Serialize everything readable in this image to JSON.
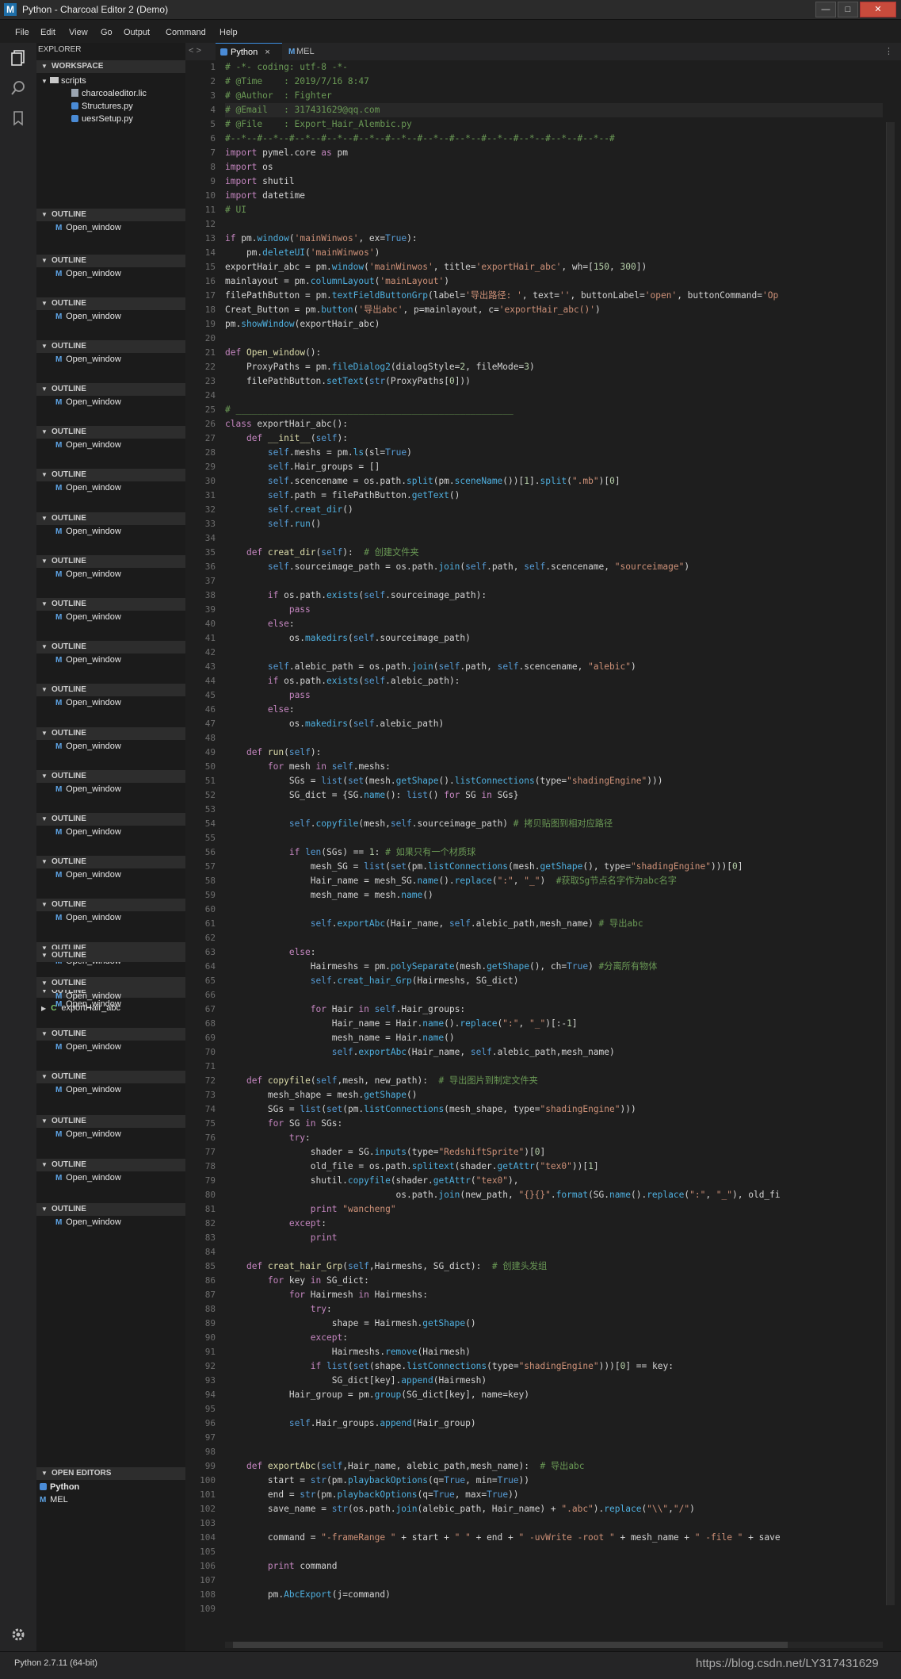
{
  "window": {
    "logo": "M",
    "title": "Python - Charcoal Editor 2 (Demo)",
    "buttons": [
      "—",
      "□",
      "✕"
    ]
  },
  "menubar": [
    "File",
    "Edit",
    "View",
    "Go",
    "Output",
    "Command",
    "Help"
  ],
  "explorer": {
    "title": "EXPLORER",
    "workspace_label": "WORKSPACE",
    "folder": "scripts",
    "files": [
      "charcoaleditor.lic",
      "Structures.py",
      "uesrSetup.py"
    ],
    "outline_label": "OUTLINE",
    "outline_item": "Open_window",
    "last_outline": [
      "Open_window",
      "exportHair_abc"
    ],
    "open_editors_label": "OPEN EDITORS",
    "open_editors": [
      "Python",
      "MEL"
    ]
  },
  "tabs": [
    {
      "label": "Python",
      "close": "×"
    },
    {
      "label": "MEL"
    }
  ],
  "code_lines": [
    "# -*- coding: utf-8 -*-",
    "# @Time    : 2019/7/16 8:47",
    "# @Author  : Fighter",
    "# @Email   : 317431629@qq.com",
    "# @File    : Export_Hair_Alembic.py",
    "#--*--#--*--#--*--#--*--#--*--#--*--#--*--#--*--#--*--#--*--#--*--#--*--#",
    "import pymel.core as pm",
    "import os",
    "import shutil",
    "import datetime",
    "# UI",
    "",
    "if pm.window('mainWinwos', ex=True):",
    "    pm.deleteUI('mainWinwos')",
    "exportHair_abc = pm.window('mainWinwos', title='exportHair_abc', wh=[150, 300])",
    "mainlayout = pm.columnLayout('mainLayout')",
    "filePathButton = pm.textFieldButtonGrp(label='导出路径: ', text='', buttonLabel='open', buttonCommand='Op",
    "Creat_Button = pm.button('导出abc', p=mainlayout, c='exportHair_abc()')",
    "pm.showWindow(exportHair_abc)",
    "",
    "def Open_window():",
    "    ProxyPaths = pm.fileDialog2(dialogStyle=2, fileMode=3)",
    "    filePathButton.setText(str(ProxyPaths[0]))",
    "",
    "# ____________________________________________________",
    "class exportHair_abc():",
    "    def __init__(self):",
    "        self.meshs = pm.ls(sl=True)",
    "        self.Hair_groups = []",
    "        self.scencename = os.path.split(pm.sceneName())[1].split(\".mb\")[0]",
    "        self.path = filePathButton.getText()",
    "        self.creat_dir()",
    "        self.run()",
    "",
    "    def creat_dir(self):  # 创建文件夹",
    "        self.sourceimage_path = os.path.join(self.path, self.scencename, \"sourceimage\")",
    "",
    "        if os.path.exists(self.sourceimage_path):",
    "            pass",
    "        else:",
    "            os.makedirs(self.sourceimage_path)",
    "",
    "        self.alebic_path = os.path.join(self.path, self.scencename, \"alebic\")",
    "        if os.path.exists(self.alebic_path):",
    "            pass",
    "        else:",
    "            os.makedirs(self.alebic_path)",
    "",
    "    def run(self):",
    "        for mesh in self.meshs:",
    "            SGs = list(set(mesh.getShape().listConnections(type=\"shadingEngine\")))",
    "            SG_dict = {SG.name(): list() for SG in SGs}",
    "",
    "            self.copyfile(mesh,self.sourceimage_path) # 拷贝贴图到相对应路径",
    "",
    "            if len(SGs) == 1: # 如果只有一个材质球",
    "                mesh_SG = list(set(pm.listConnections(mesh.getShape(), type=\"shadingEngine\")))[0]",
    "                Hair_name = mesh_SG.name().replace(\":\", \"_\")  #获取Sg节点名字作为abc名字",
    "                mesh_name = mesh.name()",
    "",
    "                self.exportAbc(Hair_name, self.alebic_path,mesh_name) # 导出abc",
    "",
    "            else:",
    "                Hairmeshs = pm.polySeparate(mesh.getShape(), ch=True) #分离所有物体",
    "                self.creat_hair_Grp(Hairmeshs, SG_dict)",
    "",
    "                for Hair in self.Hair_groups:",
    "                    Hair_name = Hair.name().replace(\":\", \"_\")[:-1]",
    "                    mesh_name = Hair.name()",
    "                    self.exportAbc(Hair_name, self.alebic_path,mesh_name)",
    "",
    "    def copyfile(self,mesh, new_path):  # 导出图片到制定文件夹",
    "        mesh_shape = mesh.getShape()",
    "        SGs = list(set(pm.listConnections(mesh_shape, type=\"shadingEngine\")))",
    "        for SG in SGs:",
    "            try:",
    "                shader = SG.inputs(type=\"RedshiftSprite\")[0]",
    "                old_file = os.path.splitext(shader.getAttr(\"tex0\"))[1]",
    "                shutil.copyfile(shader.getAttr(\"tex0\"),",
    "                                os.path.join(new_path, \"{}{}\".format(SG.name().replace(\":\", \"_\"), old_fi",
    "                print \"wancheng\"",
    "            except:",
    "                print",
    "",
    "    def creat_hair_Grp(self,Hairmeshs, SG_dict):  # 创建头发组",
    "        for key in SG_dict:",
    "            for Hairmesh in Hairmeshs:",
    "                try:",
    "                    shape = Hairmesh.getShape()",
    "                except:",
    "                    Hairmeshs.remove(Hairmesh)",
    "                if list(set(shape.listConnections(type=\"shadingEngine\")))[0] == key:",
    "                    SG_dict[key].append(Hairmesh)",
    "            Hair_group = pm.group(SG_dict[key], name=key)",
    "",
    "            self.Hair_groups.append(Hair_group)",
    "",
    "",
    "    def exportAbc(self,Hair_name, alebic_path,mesh_name):  # 导出abc",
    "        start = str(pm.playbackOptions(q=True, min=True))",
    "        end = str(pm.playbackOptions(q=True, max=True))",
    "        save_name = str(os.path.join(alebic_path, Hair_name) + \".abc\").replace(\"\\\\\",\"/\")",
    "",
    "        command = \"-frameRange \" + start + \" \" + end + \" -uvWrite -root \" + mesh_name + \" -file \" + save",
    "",
    "        print command",
    "",
    "        pm.AbcExport(j=command)",
    ""
  ],
  "status": {
    "left": "Python 2.7.11 (64-bit)",
    "watermark": "https://blog.csdn.net/LY317431629"
  }
}
